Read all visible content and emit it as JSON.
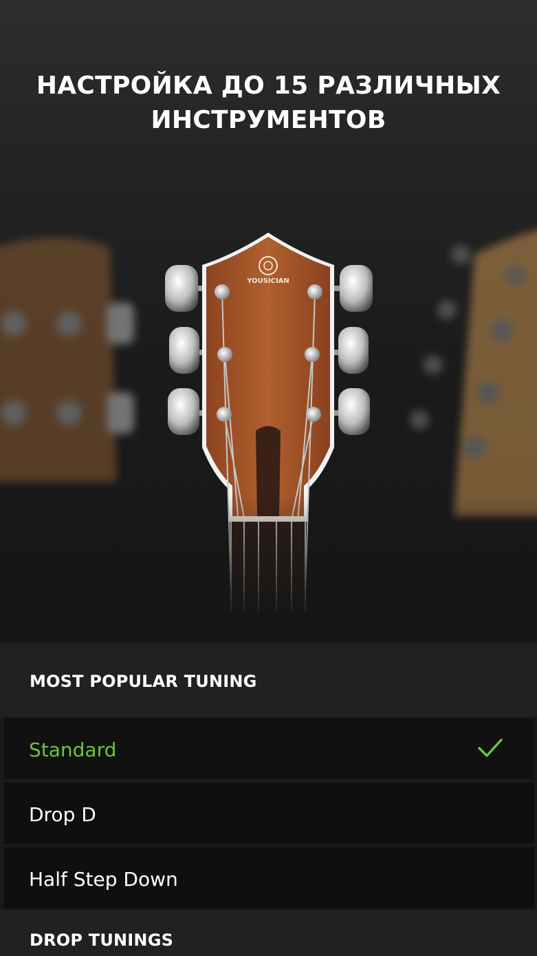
{
  "hero": {
    "title_line1": "НАСТРОЙКА ДО 15 РАЗЛИЧНЫХ",
    "title_line2": "ИНСТРУМЕНТОВ",
    "brand_logo_text": "YOUSICIAN"
  },
  "sections": [
    {
      "header": "MOST POPULAR TUNING",
      "items": [
        {
          "label": "Standard",
          "selected": true
        },
        {
          "label": "Drop D",
          "selected": false
        },
        {
          "label": "Half Step Down",
          "selected": false
        }
      ]
    },
    {
      "header": "DROP TUNINGS",
      "items": []
    }
  ],
  "icons": {
    "selected_indicator": "check-icon"
  },
  "colors": {
    "accent": "#6dc33f",
    "background": "#1a1a1a",
    "row_background": "#0f0f0f",
    "section_header_background": "#212121"
  }
}
